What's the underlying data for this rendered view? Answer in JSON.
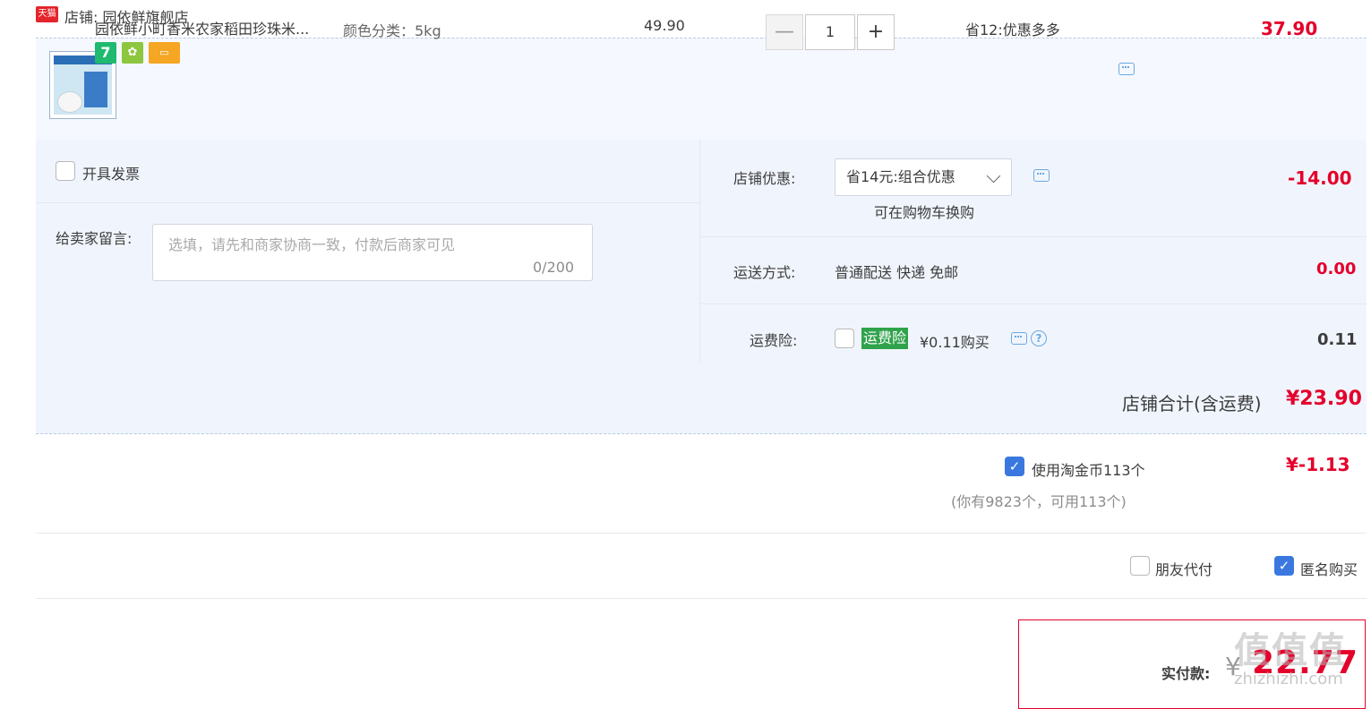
{
  "shop": {
    "logo_text": "天猫",
    "title": "店铺: 园依鲜旗舰店"
  },
  "item": {
    "name": "园依鲜小町香米农家稻田珍珠米...",
    "spec": "颜色分类：5kg",
    "badges": [
      "7",
      "✿",
      "▭"
    ],
    "unit_price": "49.90",
    "quantity": "1",
    "minus": "—",
    "plus": "+",
    "promo": "省12:优惠多多",
    "total": "37.90"
  },
  "invoice": {
    "label": "开具发票",
    "checked": false
  },
  "message": {
    "label": "给卖家留言:",
    "placeholder": "选填，请先和商家协商一致，付款后商家可见",
    "count": "0/200"
  },
  "store_discount": {
    "label": "店铺优惠:",
    "selected": "省14元:组合优惠",
    "note": "可在购物车换购",
    "value": "-14.00"
  },
  "shipping": {
    "label": "运送方式:",
    "method": "普通配送 快递 免邮",
    "value": "0.00"
  },
  "insurance": {
    "label": "运费险:",
    "tag": "运费险",
    "price_text": "¥0.11购买",
    "value": "0.11",
    "help": "?"
  },
  "subtotal": {
    "label": "店铺合计(含运费)",
    "value": "¥23.90"
  },
  "coins": {
    "label": "使用淘金币113个",
    "note": "(你有9823个，可用113个)",
    "value": "¥-1.13",
    "checked": true
  },
  "options": {
    "friend_pay": "朋友代付",
    "anonymous": "匿名购买",
    "friend_checked": false,
    "anonymous_checked": true
  },
  "payment": {
    "label": "实付款:",
    "currency": "¥",
    "amount": "22.77"
  },
  "watermark": {
    "logo": "值值值",
    "url": "zhizhizhi.com"
  },
  "colors": {
    "accent_red": "#e4002b",
    "panel_bg": "#f0f5fd",
    "check_blue": "#3a78e0",
    "insurance_green": "#2fa24b"
  }
}
